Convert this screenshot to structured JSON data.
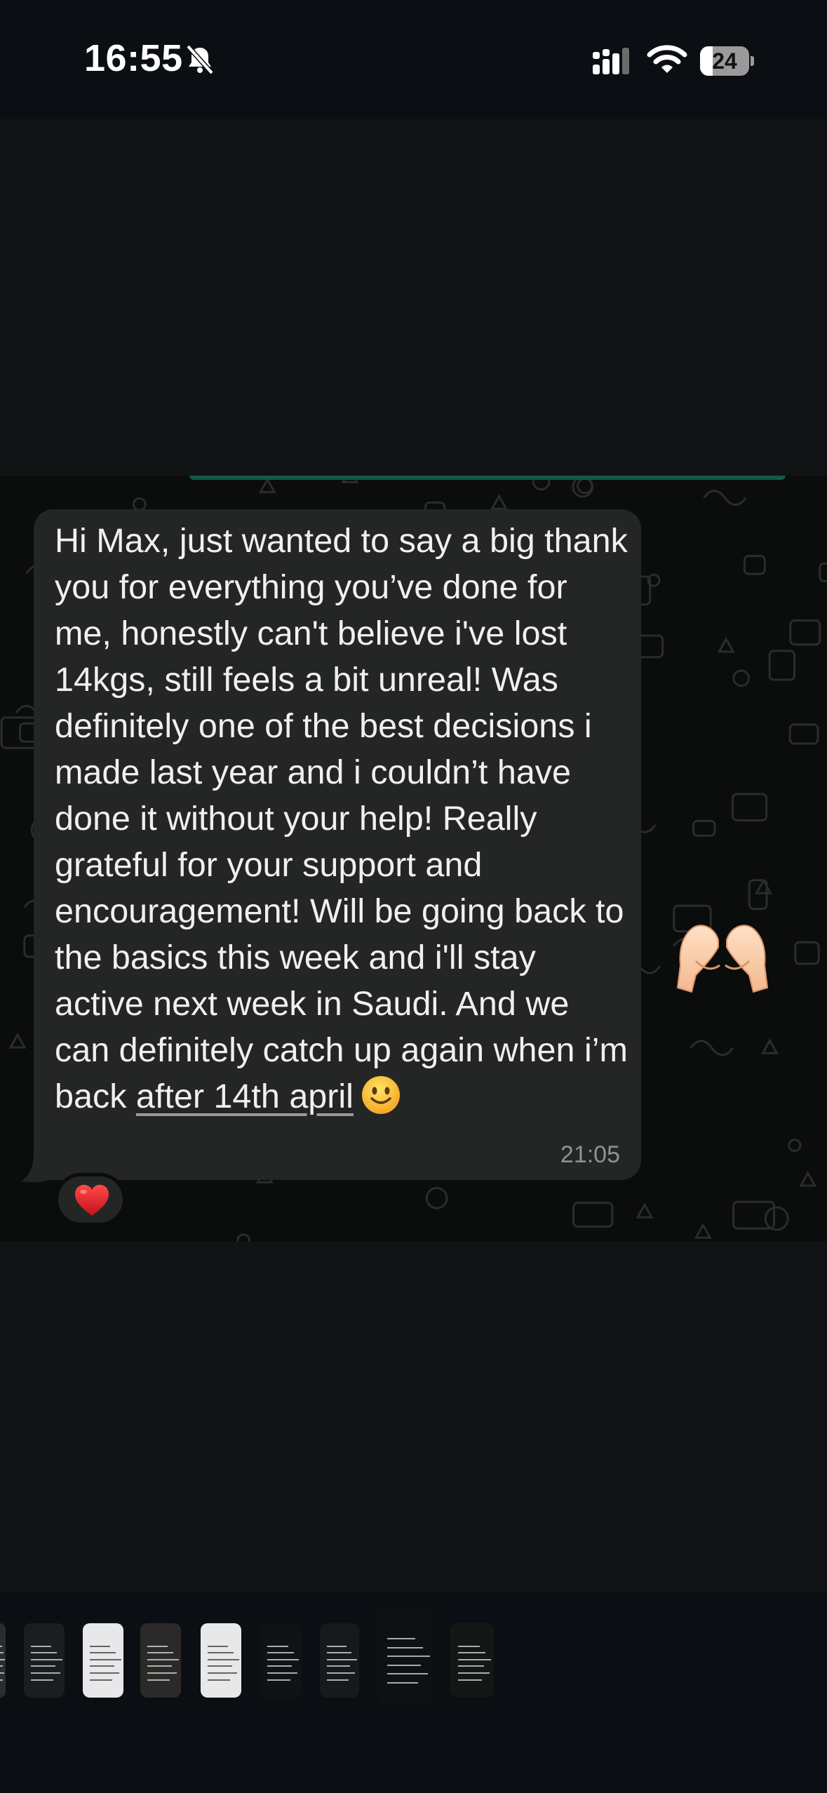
{
  "status_bar": {
    "time": "16:55",
    "battery_level": "24",
    "bell_icon": "bell-slash-icon",
    "signal_icon": "cellular-signal-icon",
    "wifi_icon": "wifi-icon"
  },
  "message": {
    "text_before_link": "Hi Max, just wanted to say a big thank you for everything you’ve done for me, honestly can't believe i've lost 14kgs, still feels a bit unreal! Was definitely one of the best decisions i made last year and i couldn’t have done it without your help! Really grateful for your support and encouragement! Will be going back to the basics this week and i'll stay active next week in Saudi. And we can definitely catch up again when i’m back ",
    "link_text": "after 14th april",
    "trailing_emoji": "slightly-smiling-face-emoji",
    "time": "21:05",
    "reaction": "red-heart-emoji"
  },
  "sticker": "heart-hands-emoji",
  "colors": {
    "background": "#121315",
    "bubble": "#242626",
    "chat_wallpaper": "#0b0c0c",
    "timestamp": "#8d9295",
    "sent_bubble_accent": "#0f5c45"
  },
  "thumbnail_strip": {
    "count": 9
  }
}
